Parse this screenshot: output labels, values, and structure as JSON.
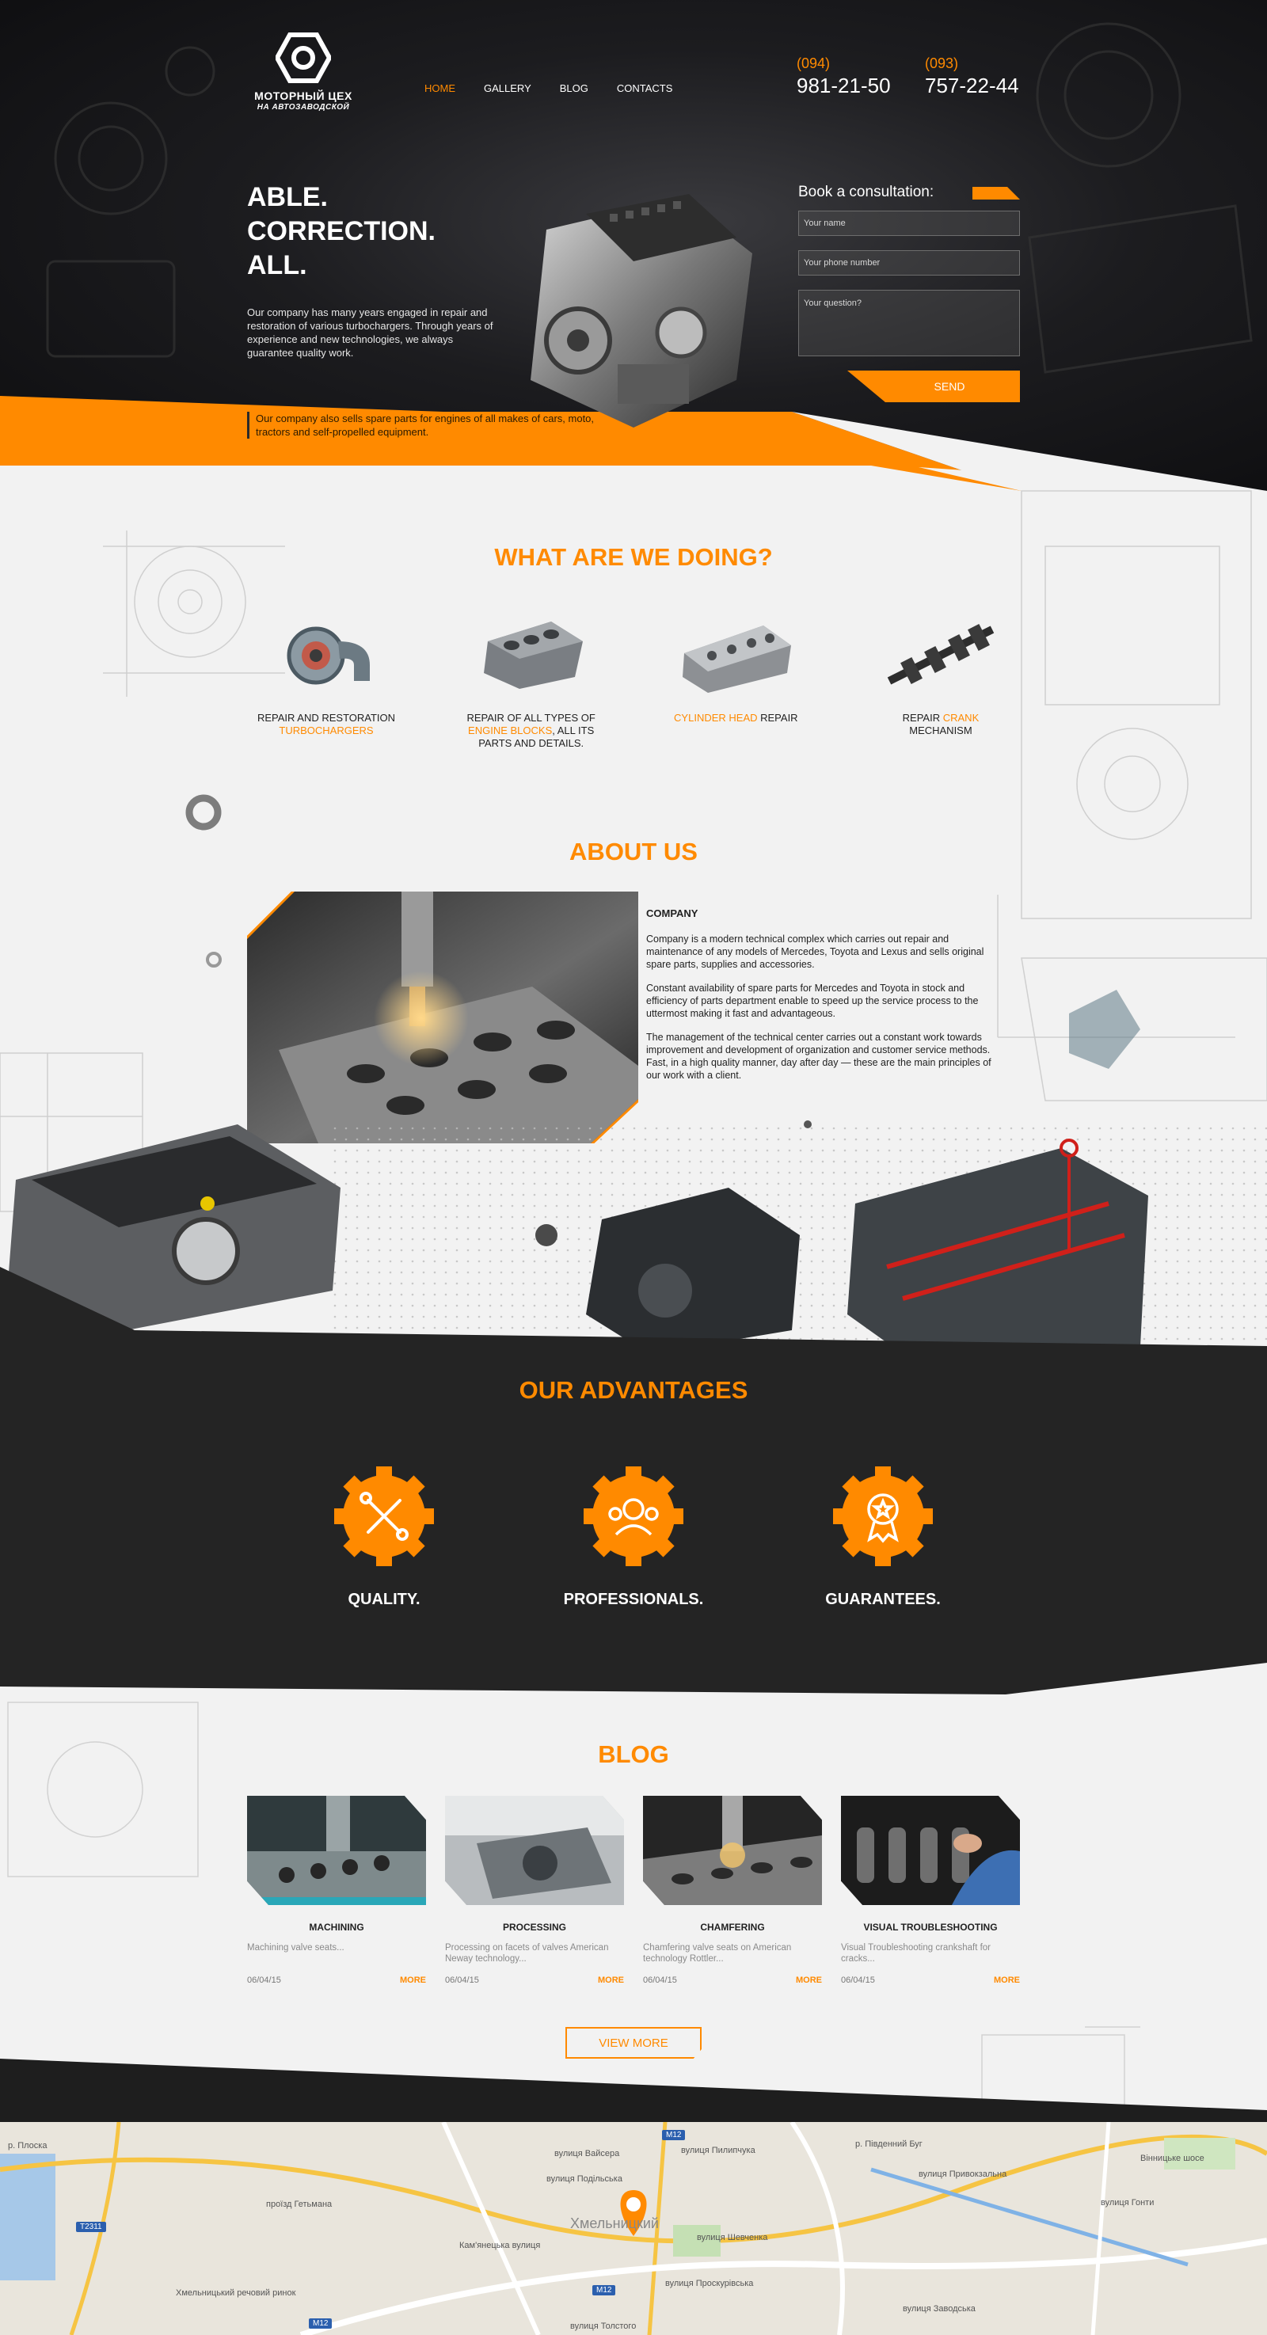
{
  "colors": {
    "accent": "#ff8a00",
    "dark": "#242424",
    "light_bg": "#f2f2f2"
  },
  "header": {
    "logo_title": "МОТОРНЫЙ ЦЕХ",
    "logo_sub": "НА АВТОЗАВОДСКОЙ",
    "nav": [
      {
        "label": "HOME",
        "active": true
      },
      {
        "label": "GALLERY",
        "active": false
      },
      {
        "label": "BLOG",
        "active": false
      },
      {
        "label": "CONTACTS",
        "active": false
      }
    ],
    "phones": [
      {
        "code": "(094)",
        "number": "981-21-50"
      },
      {
        "code": "(093)",
        "number": "757-22-44"
      }
    ]
  },
  "hero": {
    "title_lines": [
      "ABLE.",
      "CORRECTION.",
      "ALL."
    ],
    "text": "Our company has many years engaged in repair and restoration of various turbochargers. Through years of experience and new technologies, we always guarantee quality work.",
    "note": "Our company also sells spare parts for engines of all makes of cars, moto, tractors and self-propelled equipment."
  },
  "form": {
    "title": "Book a consultation:",
    "name_placeholder": "Your name",
    "phone_placeholder": "Your phone number",
    "question_placeholder": "Your question?",
    "send_label": "SEND"
  },
  "what": {
    "title": "WHAT ARE WE DOING?",
    "items": [
      {
        "pre": "REPAIR AND RESTORATION",
        "hl": "TURBOCHARGERS",
        "post": "",
        "icon": "turbocharger-image"
      },
      {
        "pre": "REPAIR OF ALL TYPES OF",
        "hl": "ENGINE BLOCKS",
        "post": ", ALL ITS PARTS AND DETAILS.",
        "icon": "engine-block-image"
      },
      {
        "pre": "",
        "hl": "CYLINDER HEAD",
        "post": " REPAIR",
        "icon": "cylinder-head-image"
      },
      {
        "pre": "REPAIR ",
        "hl": "CRANK",
        "post": "MECHANISM",
        "icon": "crankshaft-image"
      }
    ]
  },
  "about": {
    "title": "ABOUT US",
    "heading": "COMPANY",
    "paragraphs": [
      "Company is a modern technical complex which carries out repair and maintenance of any models of Mercedes, Toyota and Lexus and sells original spare parts, supplies and accessories.",
      "Constant availability of spare parts for Mercedes and Toyota in stock and efficiency of parts department enable to speed up the service process to the uttermost making it fast and advantageous.",
      "The management of the technical center carries out a constant work towards improvement and development of organization and customer service methods. Fast, in a high quality manner, day after day — these are the main principles of our work with a client."
    ]
  },
  "advantages": {
    "title": "OUR ADVANTAGES",
    "items": [
      {
        "label": "QUALITY.",
        "icon": "tools-icon"
      },
      {
        "label": "PROFESSIONALS.",
        "icon": "team-icon"
      },
      {
        "label": "GUARANTEES.",
        "icon": "award-icon"
      }
    ]
  },
  "blog": {
    "title": "BLOG",
    "more_label": "MORE",
    "view_more": "VIEW MORE",
    "posts": [
      {
        "title": "MACHINING",
        "desc": "Machining valve seats...",
        "date": "06/04/15"
      },
      {
        "title": "PROCESSING",
        "desc": "Processing on facets of valves American Neway technology...",
        "date": "06/04/15"
      },
      {
        "title": "CHAMFERING",
        "desc": "Chamfering valve seats on American technology Rottler...",
        "date": "06/04/15"
      },
      {
        "title": "VISUAL TROUBLESHOOTING",
        "desc": "Visual Troubleshooting crankshaft for cracks...",
        "date": "06/04/15"
      }
    ]
  },
  "map": {
    "city": "Хмельницкий",
    "labels": [
      "вулиця Вайсера",
      "вулиця Подільська",
      "вулиця Шевченка",
      "вулиця Проскурівська",
      "вулиця Пилипчука",
      "вулиця Привокзальна",
      "вулиця Толстого",
      "вулиця Заводська",
      "вулиця Гонти",
      "р. Плоска",
      "Хмельницький речовий ринок",
      "проїзд Гетьмана",
      "Вінницьке шосе",
      "р. Південний Буг",
      "Кам'янецька вулиця"
    ],
    "badges": [
      "M12",
      "M12",
      "M12",
      "T2311"
    ]
  }
}
